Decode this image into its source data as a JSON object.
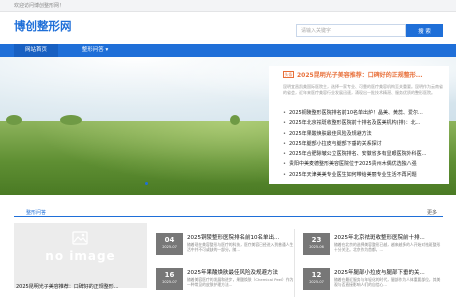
{
  "topbar": {
    "welcome": "欢迎访问博创整形网！"
  },
  "header": {
    "logo": "博创整形网"
  },
  "search": {
    "placeholder": "请输入关键字",
    "button": "搜 索"
  },
  "nav": {
    "items": [
      {
        "label": "网站首页"
      },
      {
        "label": "整形问答 ▾"
      }
    ]
  },
  "hero": {
    "featured": {
      "tag": "头条",
      "title": "2025昆明光子美容推荐：口碑好的正规整形...",
      "desc": "昆明宜昌凯美国际医院主，选择一家专业、可靠的医疗美容机构至关重要。昆明作为云南省的省会，近年来医疗美容行业发展迅速，涌现出一批技术精湛、服务优质的整形医院。"
    },
    "news": [
      "2025铜陵整形医院排名前10名单出炉！晶美、黄蕊、爱尔...",
      "2025年北京祛斑收整形医院前十排名及医美机构(排)：北...",
      "2025年果酸焕肤最佳风险及规避方法",
      "2025年腿部小拉皮与腿部下垂的关系探讨",
      "2025年合肥除皱公立医院排名、安徽省多有显眼医院外科医...",
      "贵阳中美麦德整形美容医院位于2025贵州木偶优选独八强",
      "2025年天津美美专业医生如何带给美丽专业生活不再问题"
    ]
  },
  "section": {
    "title": "整形问答",
    "more": "更多",
    "big_card": {
      "image_text": "no image",
      "caption": "2025昆明光子美容推荐：口碑好的正规整形..."
    },
    "items": [
      {
        "day": "04",
        "ym": "2025-07",
        "title": "2025铜陵整形医院排名前10名单出...",
        "desc": "随着现在美容整形与医疗的科技，医疗美容已经进入到普通人生活中并不可或缺的一部分。随..."
      },
      {
        "day": "23",
        "ym": "2025-06",
        "title": "2025年北京祛斑收整形医院前十排...",
        "desc": "随着在北京的选择美容整形已越，越来越多的人开始对祛斑整形十分关注。北京作为首都，..."
      },
      {
        "day": "16",
        "ym": "2025-07",
        "title": "2025年果酸焕肤最佳风险及规避方法",
        "desc": "随着美容医疗的发展和进步，果酸焕肤（Chemical Peel）作为一种常见的皮肤护理方法..."
      },
      {
        "day": "12",
        "ym": "2025-07",
        "title": "2025年腿部小拉皮与腿部下垂的关...",
        "desc": "随着在最近服务与年轻化的时代，腿部作为人体重要部位，其美观与否直接影响人们的自信心..."
      }
    ]
  }
}
